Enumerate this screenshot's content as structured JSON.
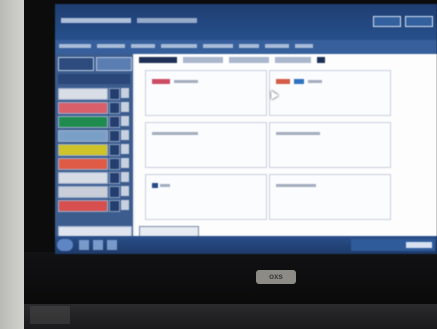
{
  "device": {
    "brand_logo": "oxs"
  },
  "palette": {
    "title_bar": "#27508c",
    "sidebar": "#3c5c8e",
    "menu_strip": "#365f9b",
    "screen_bg": "#f2f4f8",
    "bezel": "#0c0c0d",
    "sidebar_swatches": [
      "#d9dde6",
      "#d95f6a",
      "#1f8b4f",
      "#7ba0c8",
      "#cfc32a",
      "#df5b45",
      "#d7dbe4",
      "#c8cdd8",
      "#d74f4f"
    ],
    "panel_tags": [
      "#cc4c63",
      "#d45b45",
      "#2e74c1",
      "#274b87"
    ]
  },
  "icons": {
    "title_buttons": [
      "window-button-icon",
      "window-button-icon"
    ],
    "task_icons": [
      "start-icon",
      "app-icon",
      "app-icon",
      "app-icon"
    ],
    "cursor": "mouse-cursor-icon"
  }
}
